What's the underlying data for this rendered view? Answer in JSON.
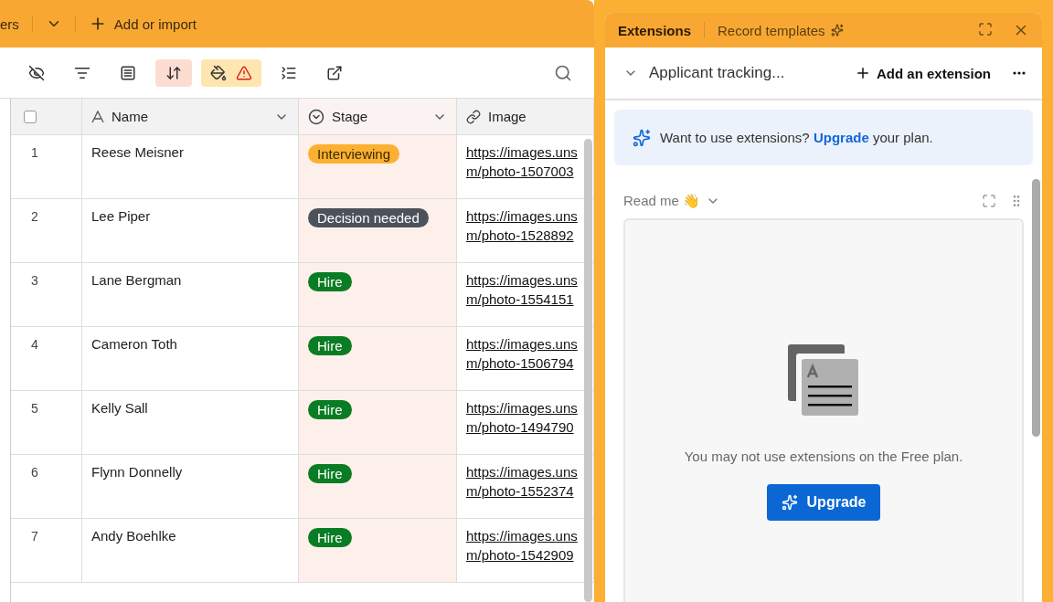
{
  "top_bar": {
    "partial_tab": "ers",
    "add_label": "Add or import"
  },
  "toolbar": {
    "tools": [
      {
        "kind": "hide",
        "active": false
      },
      {
        "kind": "filter",
        "active": false
      },
      {
        "kind": "group",
        "active": false
      },
      {
        "kind": "sort",
        "active": true
      },
      {
        "kind": "color",
        "active": true
      },
      {
        "kind": "height",
        "active": false
      },
      {
        "kind": "share",
        "active": false
      }
    ]
  },
  "table": {
    "select_all": {
      "checked": false
    },
    "columns": [
      {
        "label": "Name",
        "kind": "text"
      },
      {
        "label": "Stage",
        "kind": "select"
      },
      {
        "label": "Image",
        "kind": "link"
      }
    ],
    "rows": [
      {
        "number": "1",
        "name": "Reese Meisner",
        "stage": {
          "label": "Interviewing",
          "color": "#fcb031"
        },
        "image": [
          "https://images.uns",
          "m/photo-1507003"
        ]
      },
      {
        "number": "2",
        "name": "Lee Piper",
        "stage": {
          "label": "Decision needed",
          "color": "#4c525c"
        },
        "image": [
          "https://images.uns",
          "m/photo-1528892"
        ]
      },
      {
        "number": "3",
        "name": "Lane Bergman",
        "stage": {
          "label": "Hire",
          "color": "#0a7d24"
        },
        "image": [
          "https://images.uns",
          "m/photo-1554151"
        ]
      },
      {
        "number": "4",
        "name": "Cameron Toth",
        "stage": {
          "label": "Hire",
          "color": "#0a7d24"
        },
        "image": [
          "https://images.uns",
          "m/photo-1506794"
        ]
      },
      {
        "number": "5",
        "name": "Kelly Sall",
        "stage": {
          "label": "Hire",
          "color": "#0a7d24"
        },
        "image": [
          "https://images.uns",
          "m/photo-1494790"
        ]
      },
      {
        "number": "6",
        "name": "Flynn Donnelly",
        "stage": {
          "label": "Hire",
          "color": "#0a7d24"
        },
        "image": [
          "https://images.uns",
          "m/photo-1552374"
        ]
      },
      {
        "number": "7",
        "name": "Andy Boehlke",
        "stage": {
          "label": "Hire",
          "color": "#0a7d24"
        },
        "image": [
          "https://images.uns",
          "m/photo-1542909"
        ]
      }
    ]
  },
  "side_panel": {
    "tabs": [
      {
        "label": "Extensions",
        "selected": true
      },
      {
        "label": "Record templates",
        "selected": false
      }
    ],
    "dashboard": "Applicant tracking...",
    "add_label": "Add an extension",
    "banner": {
      "before": "Want to use extensions?",
      "link": "Upgrade",
      "after": "your plan."
    },
    "widget": {
      "title": "Read me 👋",
      "message": "You may not use extensions on the Free plan.",
      "button": "Upgrade"
    }
  }
}
